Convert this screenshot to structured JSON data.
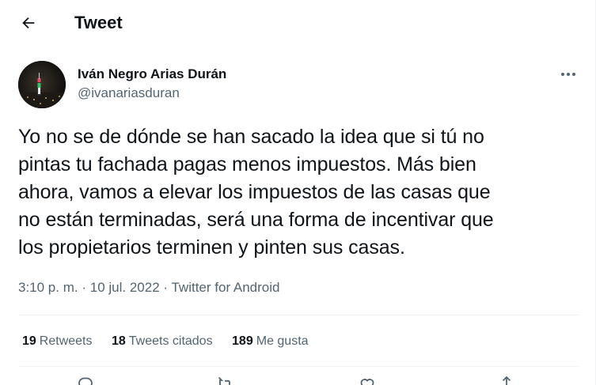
{
  "header": {
    "title": "Tweet",
    "back_icon": "arrow-left-icon"
  },
  "author": {
    "name": "Iván Negro Arias Durán",
    "handle": "@ivanariasduran",
    "avatar_icon": "city-night-avatar"
  },
  "tweet": {
    "lines": [
      "Yo no se de dónde se han sacado la idea que si tú no",
      "pintas tu fachada pagas menos impuestos. Más bien",
      "ahora, vamos a elevar los impuestos de las casas que",
      "no están terminadas, será una forma de incentivar que",
      "los propietarios terminen y pinten sus casas."
    ],
    "time": "3:10 p. m.",
    "date": "10 jul. 2022",
    "separator": "·",
    "source": "Twitter for Android"
  },
  "stats": {
    "retweets_count": "19",
    "retweets_label": "Retweets",
    "quotes_count": "18",
    "quotes_label": "Tweets citados",
    "likes_count": "189",
    "likes_label": "Me gusta"
  },
  "actions": [
    "reply-icon",
    "retweet-icon",
    "like-icon",
    "share-icon"
  ],
  "colors": {
    "text": "#0f1419",
    "secondary": "#536471",
    "divider": "#eff3f4"
  }
}
